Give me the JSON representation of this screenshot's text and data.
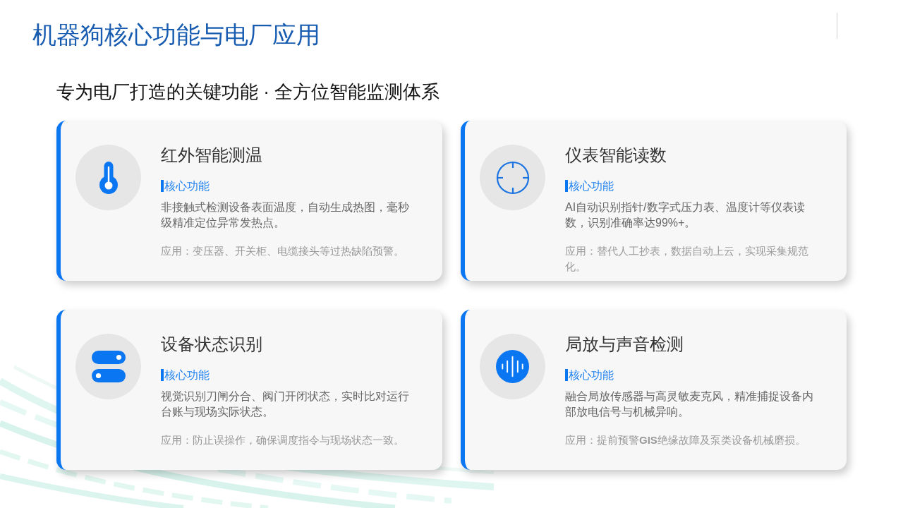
{
  "header": {
    "title": "机器狗核心功能与电厂应用"
  },
  "subtitle": "专为电厂打造的关键功能 · 全方位智能监测体系",
  "cards": [
    {
      "kind": "thermometer",
      "title": "红外智能测温",
      "tag": "核心功能",
      "description": "非接触式检测设备表面温度，自动生成热图，毫秒级精准定位异常发热点。",
      "application": "应用：变压器、开关柜、电缆接头等过热缺陷预警。"
    },
    {
      "kind": "crosshair",
      "title": "仪表智能读数",
      "tag": "核心功能",
      "description": "AI自动识别指针/数字式压力表、温度计等仪表读数，识别准确率达99%+。",
      "application": "应用：替代人工抄表，数据自动上云，实现采集规范化。"
    },
    {
      "kind": "toggles",
      "title": "设备状态识别",
      "tag": "核心功能",
      "description": "视觉识别刀闸分合、阀门开闭状态，实时比对运行台账与现场实际状态。",
      "application": "应用：防止误操作，确保调度指令与现场状态一致。"
    },
    {
      "kind": "soundwave",
      "title": "局放与声音检测",
      "tag": "核心功能",
      "description": "融合局放传感器与高灵敏麦克风，精准捕捉设备内部放电信号与机械异响。",
      "application": "应用：提前预警**GIS**绝缘故障及泵类设备机械磨损。"
    }
  ]
}
